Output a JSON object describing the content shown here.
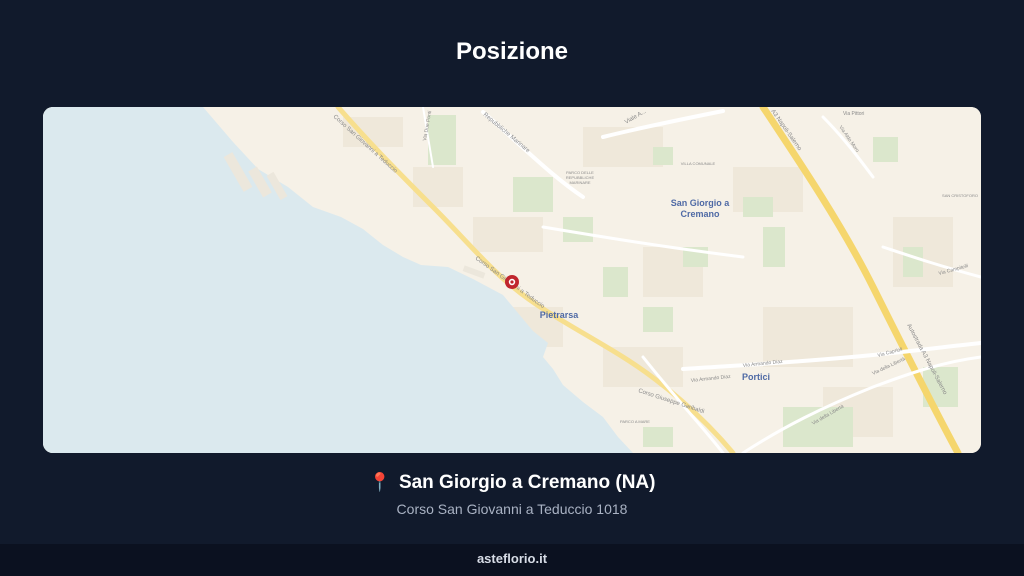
{
  "page": {
    "title": "Posizione"
  },
  "map": {
    "labels": {
      "san_giorgio": "San Giorgio a",
      "san_giorgio_2": "Cremano",
      "pietrarsa": "Pietrarsa",
      "portici": "Portici",
      "corso_sgt_top": "Corso San Giovanni a Teduccio",
      "corso_sgt_mid": "Corso San Giovanni a Teduccio",
      "repubbliche": "Repubbliche Marinare",
      "viale": "Viale A...",
      "parco_1": "PARCO DELLE",
      "parco_2": "REPUBBLICHE",
      "parco_3": "MARINARE",
      "villa_comunale": "VILLA COMUNALE",
      "san_cristoforo": "SAN CRISTOFORO",
      "autostrada_top": "A3 Napoli-Salerno",
      "autostrada_bottom": "Autostrada A3 Napoli-Salerno",
      "via_pittori": "Via Pittori",
      "via_aldo_moro": "Via Aldo Moro",
      "via_campitelli": "Via Campitelli",
      "via_diaz_1": "Via Armando Diaz",
      "via_diaz_2": "Via Armando Diaz",
      "via_caprioli": "Via Caprioli",
      "via_liberta_1": "Via della Libertà",
      "via_liberta_2": "Via della Libertà",
      "corso_garibaldi": "Corso Giuseppe Garibaldi",
      "parco_mare": "PARCO A MARE",
      "via_due_ponti": "Via Due Ponti"
    },
    "colors": {
      "sea": "#dbe9ee",
      "land": "#f6f1e7",
      "park": "#dbe7cc",
      "major_road": "#f7df8e",
      "marker": "#c0262e"
    },
    "icons": {
      "marker": "location-marker-icon"
    }
  },
  "location": {
    "icon": "pushpin-icon",
    "name": "San Giorgio a Cremano (NA)",
    "address": "Corso San Giovanni a Teduccio 1018"
  },
  "footer": {
    "site": "asteflorio.it"
  }
}
